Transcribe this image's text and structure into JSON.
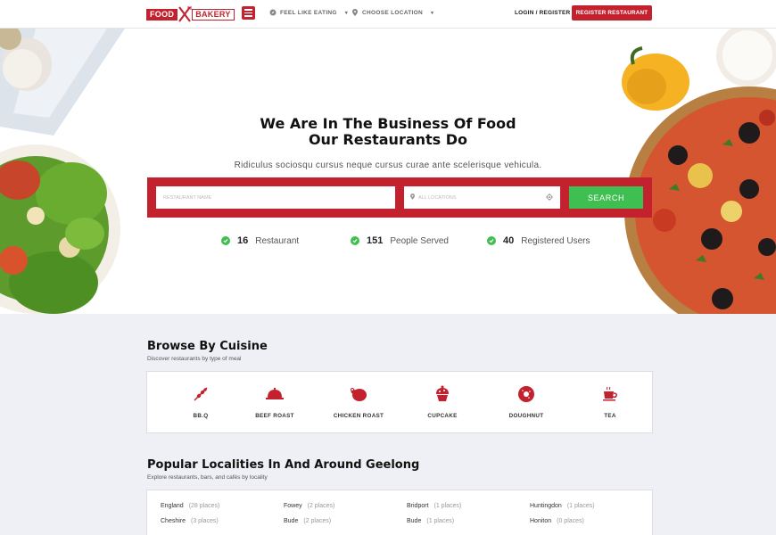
{
  "header": {
    "logo_left": "FOOD",
    "logo_right": "BAKERY",
    "feel_like_eating": "FEEL LIKE EATING",
    "choose_location": "CHOOSE LOCATION",
    "login": "LOGIN / REGISTER",
    "register": "REGISTER RESTAURANT"
  },
  "hero": {
    "title_line1": "We Are In The Business Of Food",
    "title_line2": "Our Restaurants Do",
    "subtitle": "Ridiculus sociosqu cursus neque cursus curae ante scelerisque vehicula.",
    "search_placeholder": "RESTAURANT NAME",
    "location_placeholder": "ALL LOCATIONS",
    "search_button": "SEARCH",
    "stats": [
      {
        "number": "16",
        "label": "Restaurant"
      },
      {
        "number": "151",
        "label": "People Served"
      },
      {
        "number": "40",
        "label": "Registered Users"
      }
    ]
  },
  "cuisine": {
    "title": "Browse By Cuisine",
    "subtitle": "Discover restaurants by type of meal",
    "items": [
      {
        "label": "BB.Q",
        "icon": "bbq-icon"
      },
      {
        "label": "BEEF ROAST",
        "icon": "beef-roast-icon"
      },
      {
        "label": "CHICKEN ROAST",
        "icon": "chicken-roast-icon"
      },
      {
        "label": "CUPCAKE",
        "icon": "cupcake-icon"
      },
      {
        "label": "DOUGHNUT",
        "icon": "doughnut-icon"
      },
      {
        "label": "TEA",
        "icon": "tea-icon"
      }
    ]
  },
  "localities": {
    "title": "Popular Localities In And Around Geelong",
    "subtitle": "Explore restaurants, bars, and cafés by locality",
    "items": [
      {
        "name": "England",
        "count": "(28 places)"
      },
      {
        "name": "Fowey",
        "count": "(2 places)"
      },
      {
        "name": "Bridport",
        "count": "(1 places)"
      },
      {
        "name": "Huntingdon",
        "count": "(1 places)"
      },
      {
        "name": "Cheshire",
        "count": "(3 places)"
      },
      {
        "name": "Bude",
        "count": "(2 places)"
      },
      {
        "name": "Bude",
        "count": "(1 places)"
      },
      {
        "name": "Honiton",
        "count": "(0 places)"
      }
    ]
  },
  "colors": {
    "brand_red": "#c4212e",
    "accent_green": "#3fbf51",
    "section_bg": "#eef0f5"
  }
}
